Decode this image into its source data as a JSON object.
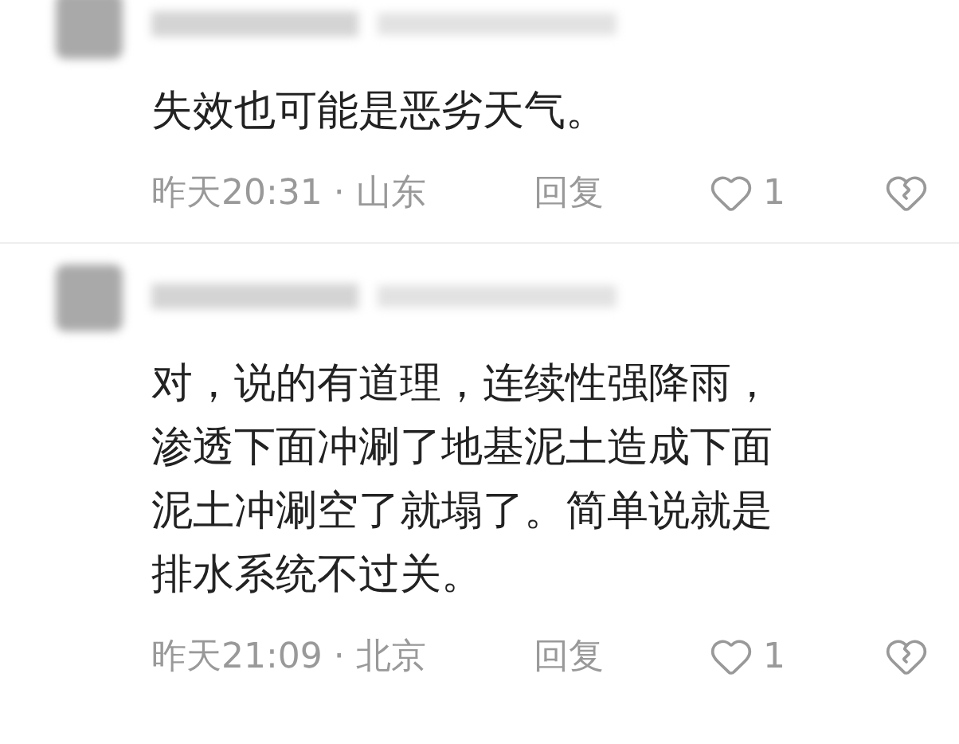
{
  "comments": [
    {
      "text": "失效也可能是恶劣天气。",
      "meta": "昨天20:31 · 山东",
      "reply": "回复",
      "likes": "1"
    },
    {
      "text": "对，说的有道理，连续性强降雨，渗透下面冲涮了地基泥土造成下面泥土冲涮空了就塌了。简单说就是排水系统不过关。",
      "meta": "昨天21:09 · 北京",
      "reply": "回复",
      "likes": "1"
    }
  ]
}
